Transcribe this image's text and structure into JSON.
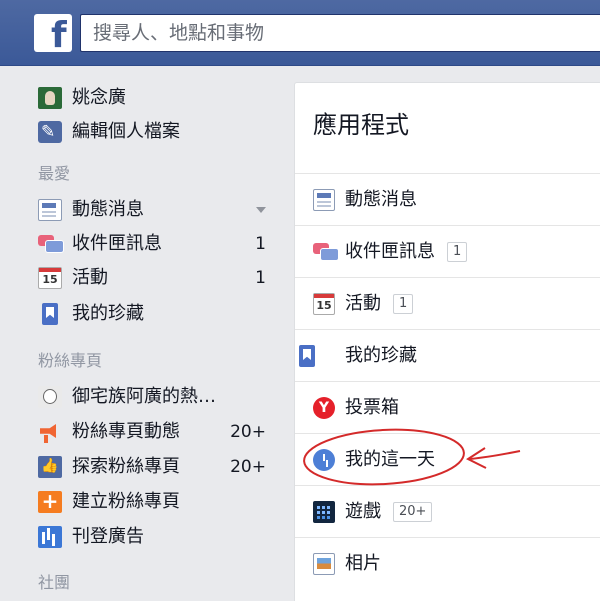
{
  "header": {
    "logo_letter": "f",
    "search_placeholder": "搜尋人、地點和事物",
    "brand_color": "#3b5998"
  },
  "sidebar": {
    "profile": {
      "name": "姚念廣",
      "edit_label": "編輯個人檔案"
    },
    "favorites_heading": "最愛",
    "favorites": [
      {
        "label": "動態消息",
        "icon": "news-feed-icon",
        "count": ""
      },
      {
        "label": "收件匣訊息",
        "icon": "messages-icon",
        "count": "1"
      },
      {
        "label": "活動",
        "icon": "calendar-icon",
        "count": "1"
      },
      {
        "label": "我的珍藏",
        "icon": "saved-bookmark-icon",
        "count": ""
      }
    ],
    "pages_heading": "粉絲專頁",
    "pages": [
      {
        "label": "御宅族阿廣的熱…",
        "icon": "page-avatar-icon",
        "count": ""
      },
      {
        "label": "粉絲專頁動態",
        "icon": "megaphone-icon",
        "count": "20+"
      },
      {
        "label": "探索粉絲專頁",
        "icon": "thumbs-up-icon",
        "count": "20+"
      },
      {
        "label": "建立粉絲專頁",
        "icon": "create-page-icon",
        "count": ""
      },
      {
        "label": "刊登廣告",
        "icon": "ads-chart-icon",
        "count": ""
      }
    ],
    "groups_heading": "社團",
    "calendar_day": "15"
  },
  "panel": {
    "title": "應用程式",
    "apps": [
      {
        "label": "動態消息",
        "icon": "news-feed-icon",
        "badge": ""
      },
      {
        "label": "收件匣訊息",
        "icon": "messages-icon",
        "badge": "1"
      },
      {
        "label": "活動",
        "icon": "calendar-icon",
        "badge": "1"
      },
      {
        "label": "我的珍藏",
        "icon": "saved-bookmark-icon",
        "badge": ""
      },
      {
        "label": "投票箱",
        "icon": "poll-icon",
        "badge": ""
      },
      {
        "label": "我的這一天",
        "icon": "on-this-day-clock-icon",
        "badge": ""
      },
      {
        "label": "遊戲",
        "icon": "games-icon",
        "badge": "20+"
      },
      {
        "label": "相片",
        "icon": "photos-icon",
        "badge": ""
      }
    ]
  },
  "annotation": {
    "color": "#d42a2a"
  }
}
